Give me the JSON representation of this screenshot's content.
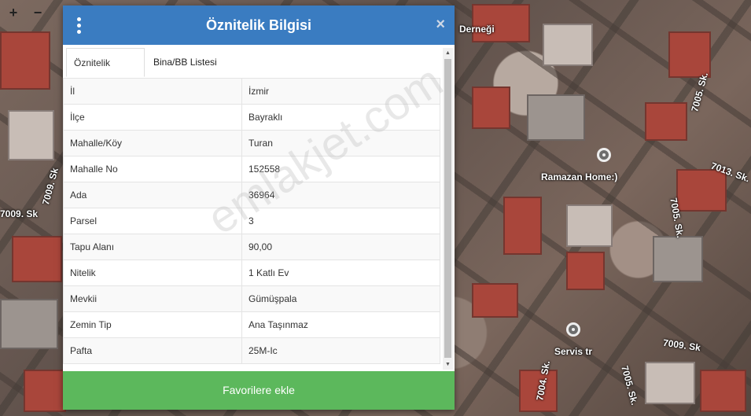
{
  "map": {
    "zoom_in_label": "+",
    "zoom_out_label": "−",
    "streets": [
      "7009. Sk",
      "7005. Sk.",
      "7013. Sk.",
      "7005. Sk.",
      "7009. Sk",
      "7004. Sk.",
      "7005. Sk.",
      "7009. Sk",
      "Derneği"
    ],
    "pois": [
      "Ramazan Home:)",
      "Servis tr"
    ]
  },
  "dialog": {
    "title": "Öznitelik Bilgisi",
    "close_label": "×",
    "tabs": [
      {
        "label": "Öznitelik Bilgisi",
        "active": true
      },
      {
        "label": "Bina/BB Listesi",
        "active": false
      }
    ],
    "rows": [
      {
        "key": "İl",
        "value": "İzmir"
      },
      {
        "key": "İlçe",
        "value": "Bayraklı"
      },
      {
        "key": "Mahalle/Köy",
        "value": "Turan"
      },
      {
        "key": "Mahalle No",
        "value": "152558"
      },
      {
        "key": "Ada",
        "value": "36964"
      },
      {
        "key": "Parsel",
        "value": "3"
      },
      {
        "key": "Tapu Alanı",
        "value": "90,00"
      },
      {
        "key": "Nitelik",
        "value": "1 Katlı Ev"
      },
      {
        "key": "Mevkii",
        "value": "Gümüşpala"
      },
      {
        "key": "Zemin Tip",
        "value": "Ana Taşınmaz"
      },
      {
        "key": "Pafta",
        "value": "25M-Ic"
      }
    ],
    "favorite_button": "Favorilere ekle"
  },
  "watermark": "emlakjet.com",
  "colors": {
    "header": "#3a7cc1",
    "favorite_button": "#5cb85c"
  }
}
